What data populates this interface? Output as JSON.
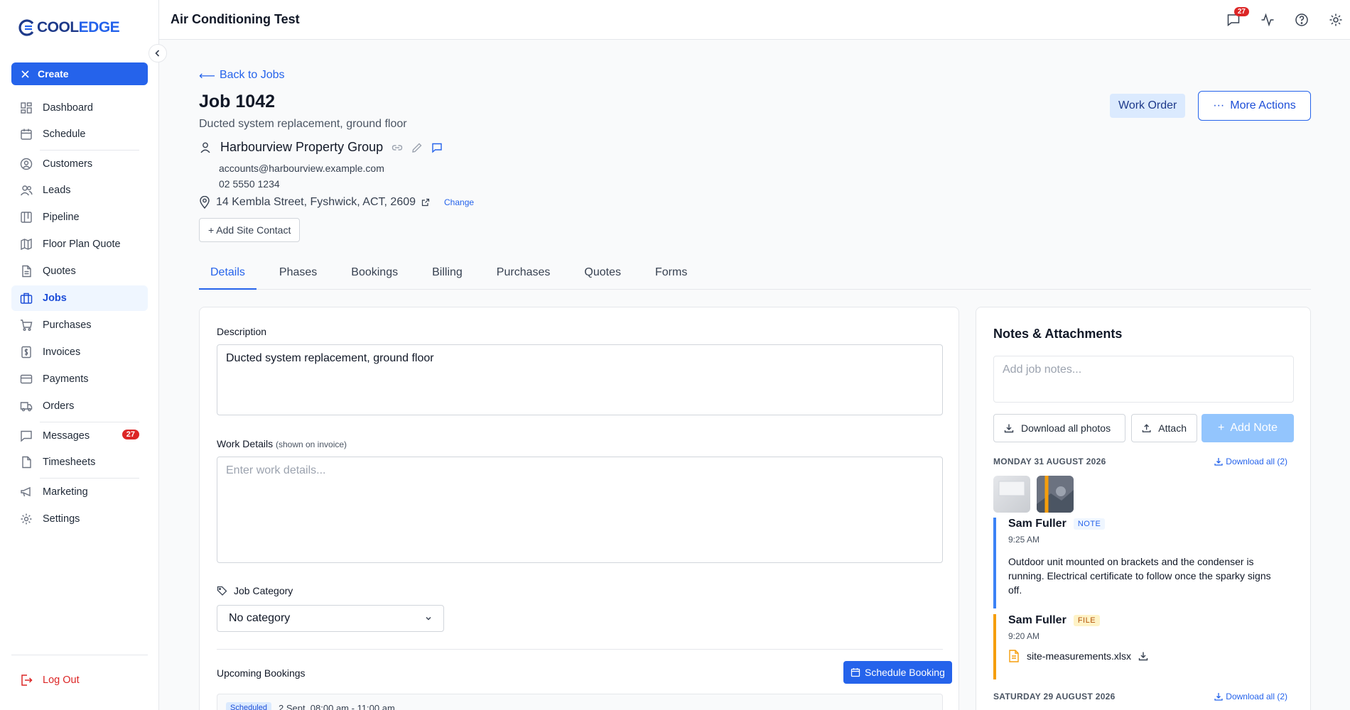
{
  "app": {
    "logo_text_a": "COOL",
    "logo_text_b": "EDGE",
    "create_label": "Create",
    "logout_label": "Log Out"
  },
  "sidebar": {
    "items": [
      {
        "label": "Dashboard",
        "icon": "dashboard-icon"
      },
      {
        "label": "Schedule",
        "icon": "calendar-icon"
      },
      {
        "label": "Customers",
        "icon": "user-circle-icon"
      },
      {
        "label": "Leads",
        "icon": "users-icon"
      },
      {
        "label": "Pipeline",
        "icon": "pipeline-icon"
      },
      {
        "label": "Floor Plan Quote",
        "icon": "map-icon"
      },
      {
        "label": "Quotes",
        "icon": "document-icon"
      },
      {
        "label": "Jobs",
        "icon": "briefcase-icon"
      },
      {
        "label": "Purchases",
        "icon": "cart-icon"
      },
      {
        "label": "Invoices",
        "icon": "dollar-document-icon"
      },
      {
        "label": "Payments",
        "icon": "credit-card-icon"
      },
      {
        "label": "Orders",
        "icon": "truck-icon"
      },
      {
        "label": "Messages",
        "icon": "message-icon",
        "badge": "27"
      },
      {
        "label": "Timesheets",
        "icon": "timesheet-icon"
      },
      {
        "label": "Marketing",
        "icon": "megaphone-icon"
      },
      {
        "label": "Settings",
        "icon": "gear-icon"
      }
    ],
    "active": "Jobs"
  },
  "topbar": {
    "title": "Air Conditioning Test",
    "messages_badge": "27"
  },
  "job": {
    "back_label": "Back to Jobs",
    "title": "Job 1042",
    "subtitle": "Ducted system replacement, ground floor",
    "customer_name": "Harbourview Property Group",
    "customer_email": "accounts@harbourview.example.com",
    "customer_phone": "02 5550 1234",
    "address": "14 Kembla Street, Fyshwick, ACT, 2609",
    "change_label": "Change",
    "add_contact_label": "+ Add Site Contact",
    "work_order_label": "Work Order",
    "more_actions_label": "More Actions"
  },
  "tabs": [
    "Details",
    "Phases",
    "Bookings",
    "Billing",
    "Purchases",
    "Quotes",
    "Forms"
  ],
  "details": {
    "description_label": "Description",
    "description_value": "Ducted system replacement, ground floor",
    "work_details_label": "Work Details",
    "work_details_hint": "(shown on invoice)",
    "work_details_placeholder": "Enter work details...",
    "category_label": "Job Category",
    "category_value": "No category",
    "upcoming_label": "Upcoming Bookings",
    "schedule_label": "Schedule Booking",
    "booking_status": "Scheduled",
    "booking_time": "2 Sept, 08:00 am - 11:00 am"
  },
  "notes": {
    "title": "Notes & Attachments",
    "placeholder": "Add job notes...",
    "download_photos_label": "Download all photos",
    "attach_label": "Attach",
    "add_note_label": "Add Note",
    "group1_date": "MONDAY 31 AUGUST 2026",
    "group1_download": "Download all (2)",
    "entry1_author": "Sam Fuller",
    "entry1_tag": "NOTE",
    "entry1_time": "9:25 AM",
    "entry1_text": "Outdoor unit mounted on brackets and the condenser is running. Electrical certificate to follow once the sparky signs off.",
    "entry2_author": "Sam Fuller",
    "entry2_tag": "FILE",
    "entry2_time": "9:20 AM",
    "entry2_file": "site-measurements.xlsx",
    "group2_date": "SATURDAY 29 AUGUST 2026",
    "group2_download": "Download all (2)"
  }
}
